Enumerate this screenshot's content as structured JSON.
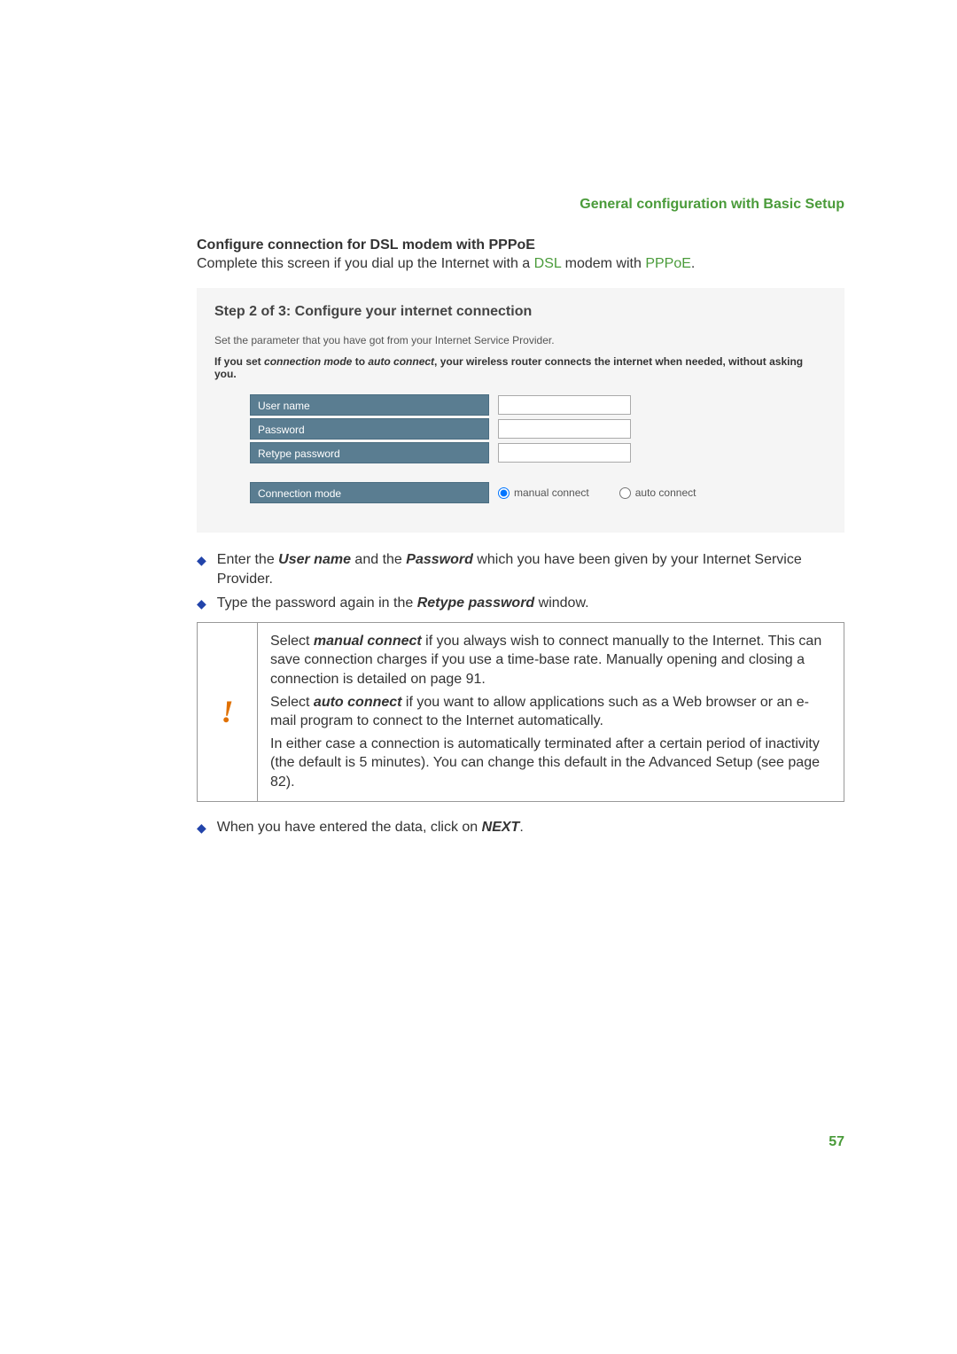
{
  "header": {
    "breadcrumb": "General configuration with Basic Setup"
  },
  "section": {
    "title": "Configure connection for DSL modem with PPPoE",
    "intro_pre": "Complete this screen if you dial up the Internet with a ",
    "intro_link1": "DSL",
    "intro_mid": " modem with ",
    "intro_link2": "PPPoE",
    "intro_post": "."
  },
  "screenshot": {
    "step_title": "Step 2 of 3: Configure your internet connection",
    "desc": "Set the parameter that you have got from your Internet Service Provider.",
    "note_pre": "If you set ",
    "note_em1": "connection mode",
    "note_mid": " to ",
    "note_em2": "auto connect",
    "note_post": ", your wireless router connects the internet when needed, without asking you.",
    "labels": {
      "username": "User name",
      "password": "Password",
      "retype": "Retype password",
      "connmode": "Connection mode"
    },
    "radio": {
      "manual": "manual connect",
      "auto": "auto connect"
    }
  },
  "bullets": {
    "b1_pre": "Enter the ",
    "b1_u": "User name",
    "b1_mid": " and the ",
    "b1_p": "Password",
    "b1_post": " which you have been given by your Internet Service Provider.",
    "b2_pre": "Type the password again in the ",
    "b2_r": "Retype password",
    "b2_post": " window."
  },
  "tip": {
    "p1_pre": "Select ",
    "p1_b": "manual connect",
    "p1_post": " if you always wish to connect manually to the Internet. This can save connection charges if you use a time-base rate. Manually opening and closing a connection is detailed on page 91.",
    "p2_pre": "Select ",
    "p2_b": "auto connect",
    "p2_post": " if you want to allow applications such as a Web browser or an e-mail program to connect to the Internet automatically.",
    "p3": "In either case a connection is automatically terminated after a certain period of inactivity (the default is 5 minutes). You can change this default in the Advanced Setup (see page 82)."
  },
  "final": {
    "pre": "When you have entered the data, click on ",
    "b": "NEXT",
    "post": "."
  },
  "page_number": "57"
}
